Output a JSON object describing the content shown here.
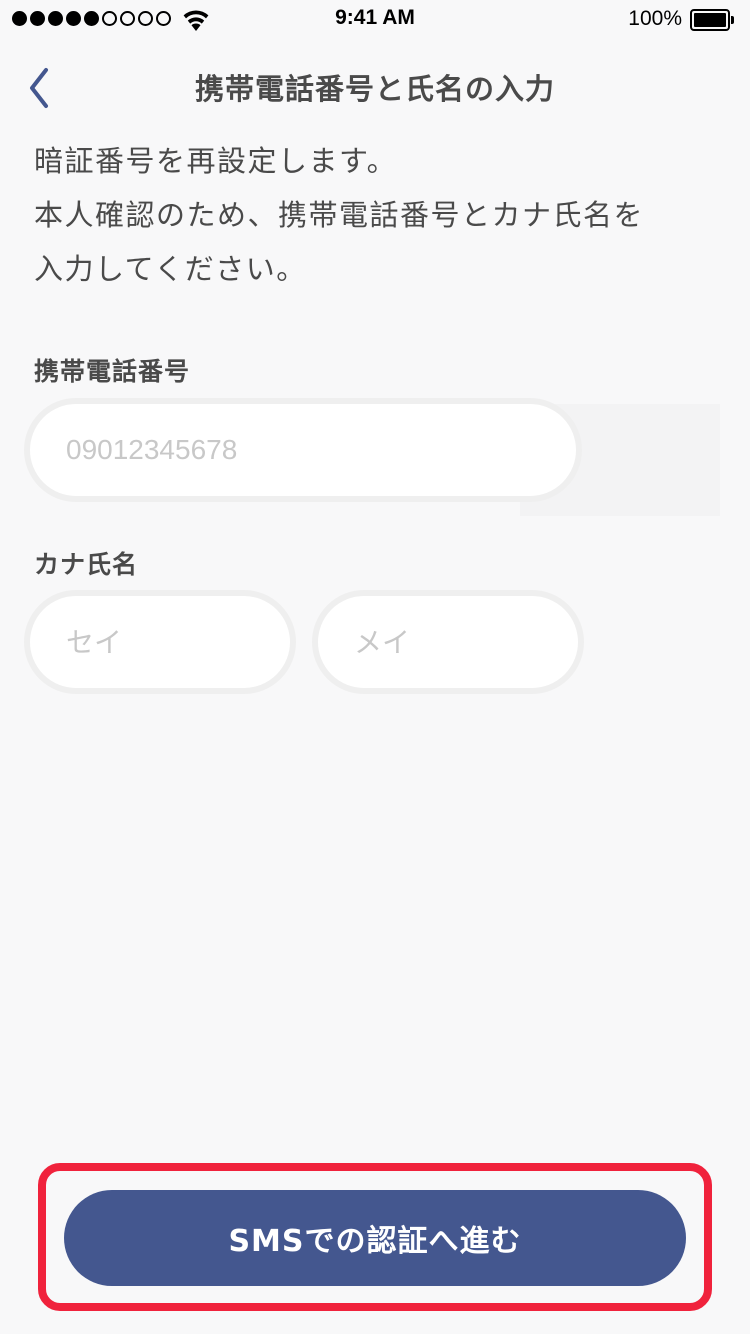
{
  "status_bar": {
    "carrier_signal": {
      "filled": 5,
      "empty": 4
    },
    "time": "9:41 AM",
    "battery_percent": "100%"
  },
  "nav": {
    "back_icon": "chevron-left-icon",
    "title": "携帯電話番号と氏名の入力"
  },
  "intro": {
    "lines": [
      "暗証番号を再設定します。",
      "本人確認のため、携帯電話番号とカナ氏名を",
      "入力してください。"
    ]
  },
  "form": {
    "phone": {
      "label": "携帯電話番号",
      "placeholder": "09012345678",
      "value": ""
    },
    "kana_name": {
      "label": "カナ氏名",
      "sei_placeholder": "セイ",
      "mei_placeholder": "メイ",
      "sei_value": "",
      "mei_value": ""
    }
  },
  "actions": {
    "submit_label": "SMSでの認証へ進む"
  },
  "colors": {
    "background": "#f8f8f9",
    "primary": "#44578f",
    "highlight": "#f0223c",
    "text": "#4a4a4a",
    "placeholder": "#c8c8c8",
    "back_chevron": "#44578f"
  }
}
